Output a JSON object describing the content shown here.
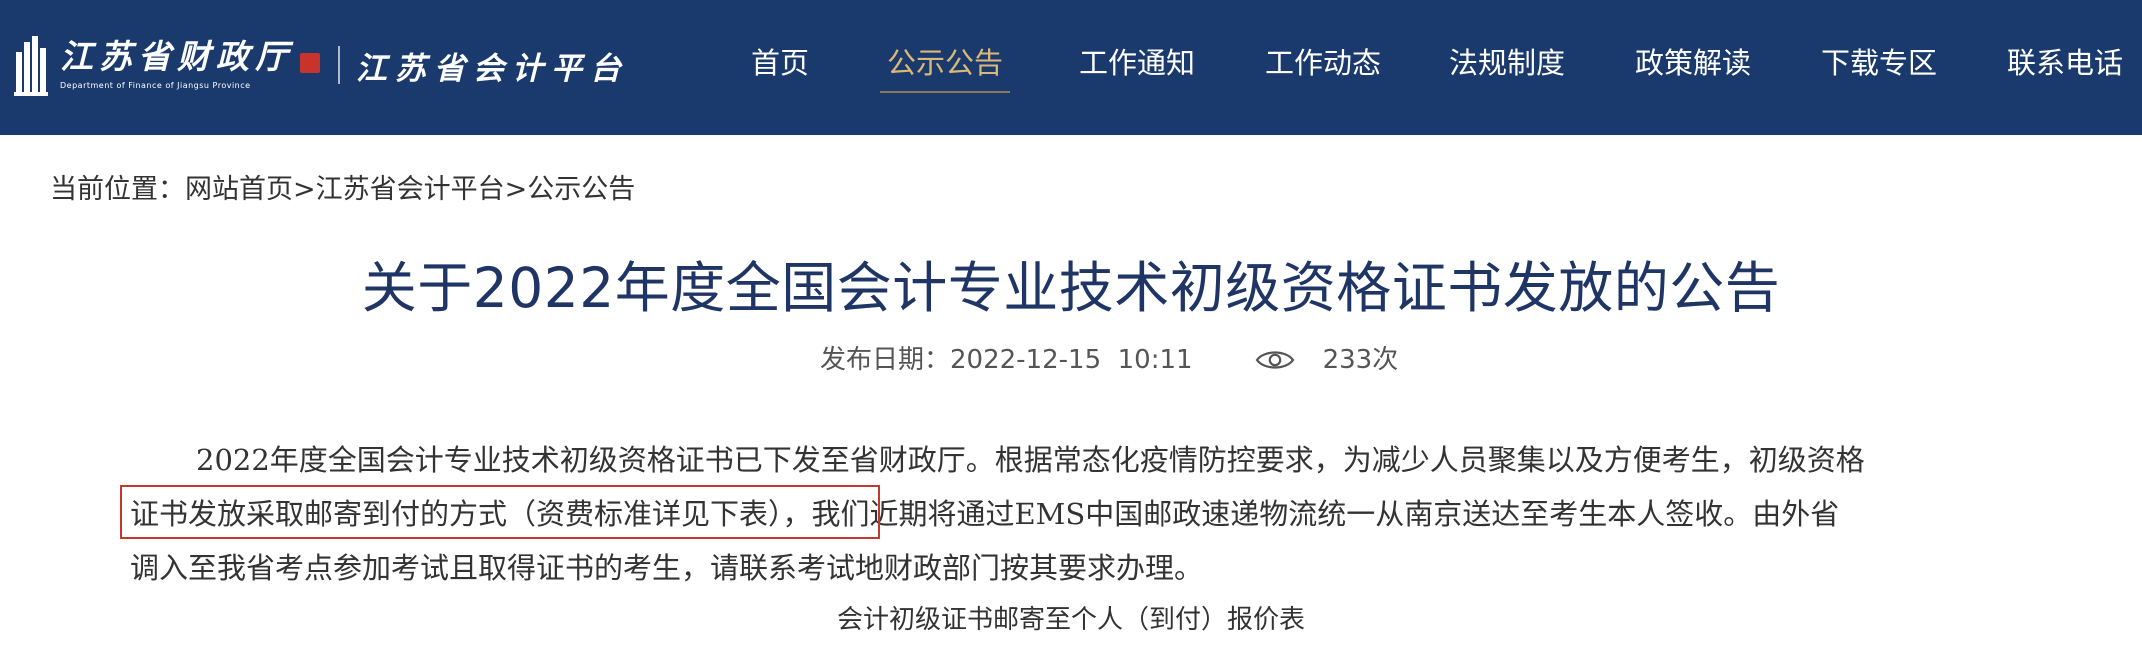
{
  "header": {
    "logo_title": "江苏省财政厅",
    "logo_subtitle": "Department of Finance of Jiangsu Province",
    "platform_name": "江苏省会计平台",
    "nav": [
      {
        "label": "首页",
        "active": false
      },
      {
        "label": "公示公告",
        "active": true
      },
      {
        "label": "工作通知",
        "active": false
      },
      {
        "label": "工作动态",
        "active": false
      },
      {
        "label": "法规制度",
        "active": false
      },
      {
        "label": "政策解读",
        "active": false
      },
      {
        "label": "下载专区",
        "active": false
      },
      {
        "label": "联系电话",
        "active": false
      }
    ]
  },
  "breadcrumb": {
    "prefix": "当前位置：",
    "items": [
      "网站首页",
      "江苏省会计平台",
      "公示公告"
    ],
    "separator": ">"
  },
  "article": {
    "title": "关于2022年度全国会计专业技术初级资格证书发放的公告",
    "publish_label": "发布日期：",
    "publish_datetime": "2022-12-15  10:11",
    "views": "233次",
    "paragraph_lines": [
      "2022年度全国会计专业技术初级资格证书已下发至省财政厅。根据常态化疫情防控要求，为减少人员聚集以及方便考生，初级资格",
      "证书发放采取邮寄到付的方式（资费标准详见下表），我们近期将通过EMS中国邮政速递物流统一从南京送达至考生本人签收。由外省",
      "调入至我省考点参加考试且取得证书的考生，请联系考试地财政部门按其要求办理。"
    ],
    "table_caption": "会计初级证书邮寄至个人（到付）报价表"
  },
  "colors": {
    "header_bg": "#1a3a6e",
    "nav_active": "#d9b878",
    "title_color": "#1e3565",
    "highlight_border": "#c0392b"
  },
  "icons": {
    "logo": "building-emblem-icon",
    "seal": "red-seal-icon",
    "views": "eye-icon"
  }
}
